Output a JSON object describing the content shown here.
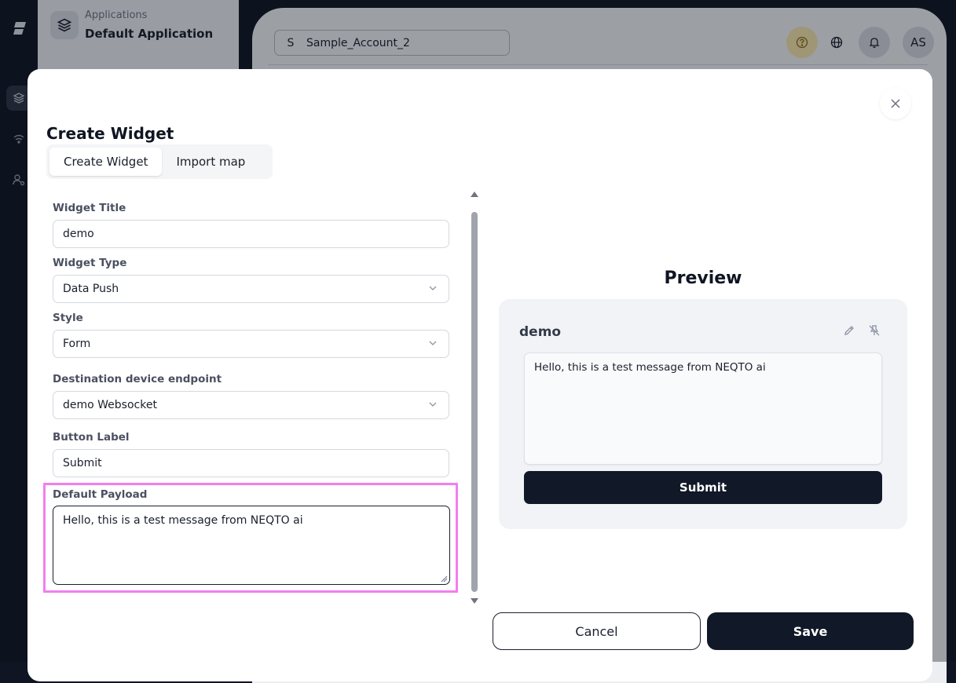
{
  "sidebar": {
    "app_kicker": "Applications",
    "app_name": "Default Application",
    "icons": [
      "logo-icon",
      "layers-icon",
      "wifi-icon",
      "user-settings-icon"
    ]
  },
  "header": {
    "account_initial": "S",
    "account_name": "Sample_Account_2",
    "help_icon": "help-icon",
    "avatar": "AS"
  },
  "modal": {
    "title": "Create Widget",
    "tabs": [
      {
        "label": "Create Widget",
        "active": true
      },
      {
        "label": "Import map",
        "active": false
      }
    ],
    "form": {
      "title_label": "Widget Title",
      "title_value": "demo",
      "type_label": "Widget Type",
      "type_value": "Data Push",
      "style_label": "Style",
      "style_value": "Form",
      "endpoint_label": "Destination device endpoint",
      "endpoint_value": "demo Websocket",
      "button_label_label": "Button Label",
      "button_label_value": "Submit",
      "payload_label": "Default Payload",
      "payload_value": "Hello, this is a test message from NEQTO ai"
    },
    "preview": {
      "heading": "Preview",
      "widget_name": "demo",
      "message": "Hello, this is a test message from NEQTO ai",
      "submit_label": "Submit"
    },
    "actions": {
      "cancel_label": "Cancel",
      "save_label": "Save"
    }
  },
  "colors": {
    "primary_dark": "#111827",
    "highlight": "#f27ef0",
    "help_bg": "#efdfa8"
  }
}
